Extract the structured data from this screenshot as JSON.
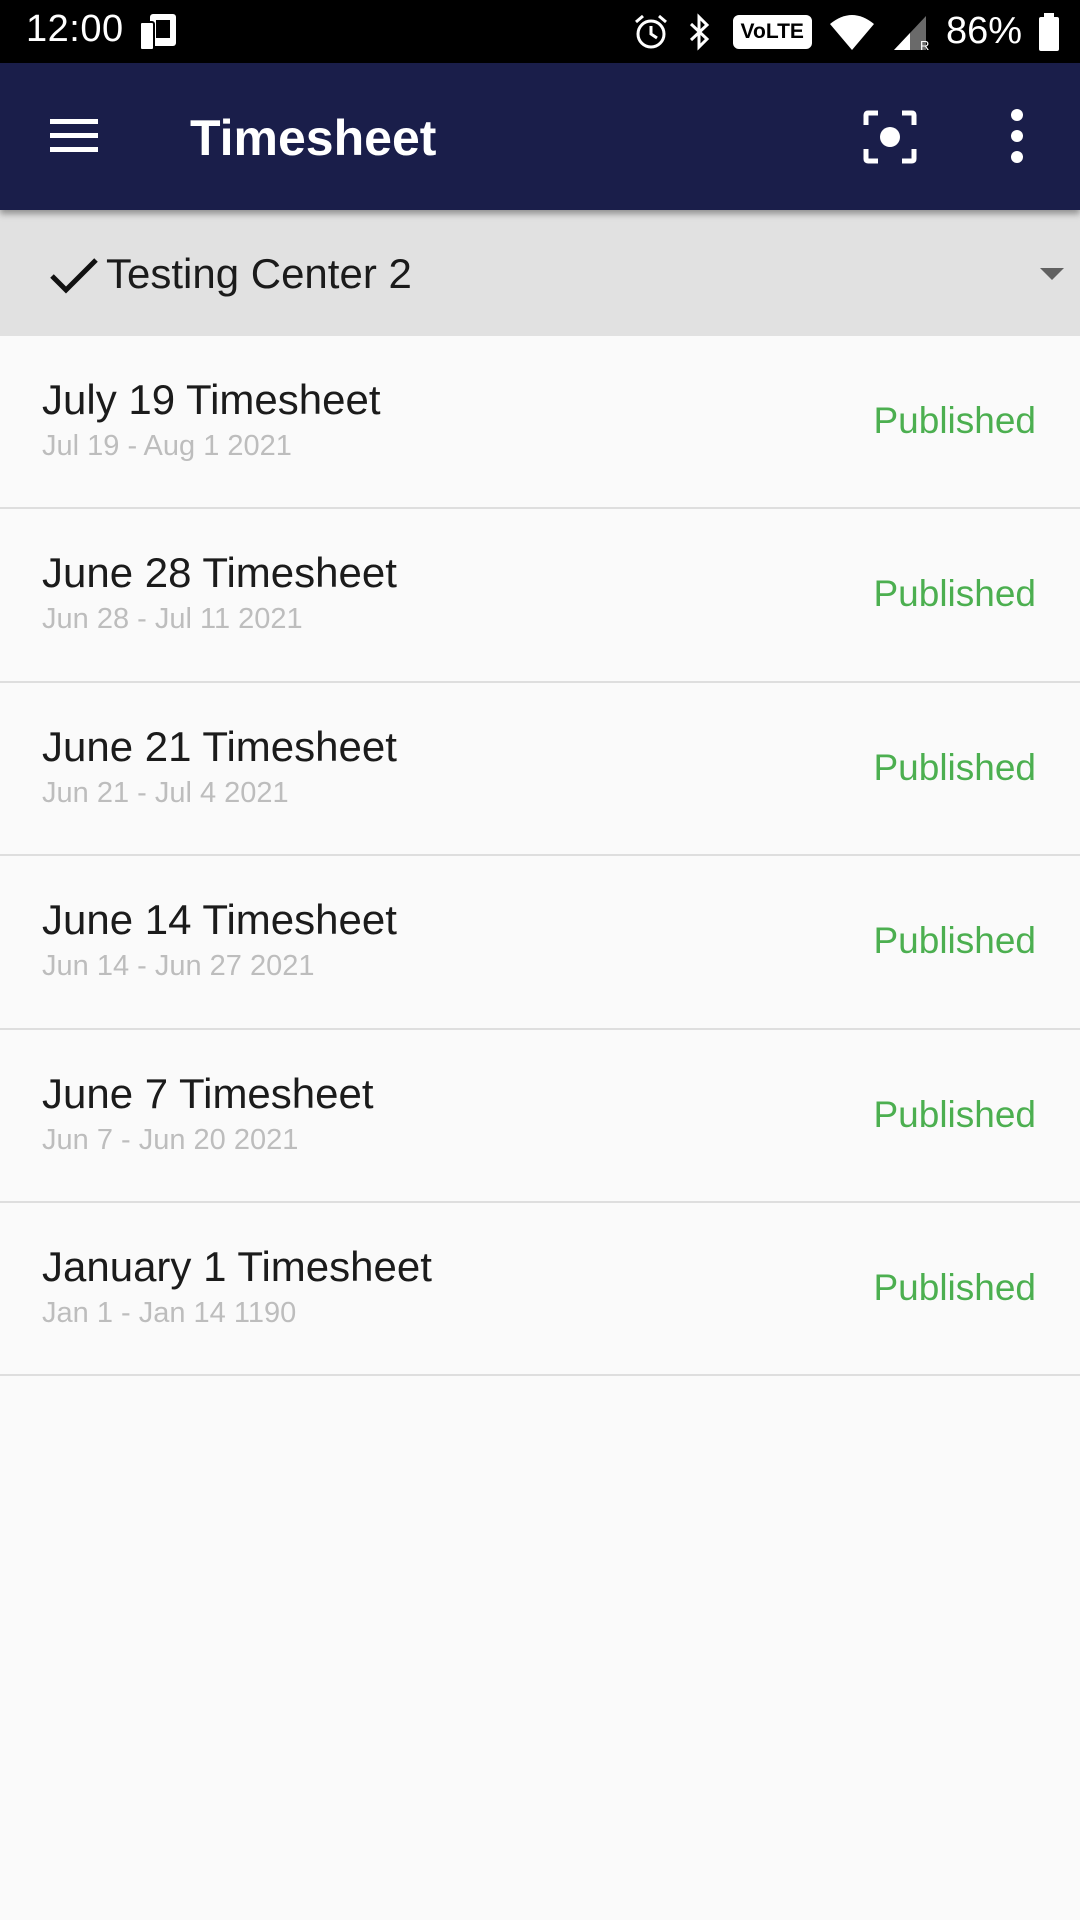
{
  "status_bar": {
    "time": "12:00",
    "volte": "VoLTE",
    "battery": "86%",
    "icons": [
      "phone-sim-icon",
      "alarm-icon",
      "bluetooth-icon",
      "volte-icon",
      "wifi-icon",
      "signal-icon",
      "battery-icon"
    ]
  },
  "app_bar": {
    "title": "Timesheet",
    "icons": [
      "menu-icon",
      "focus-scan-icon",
      "more-vert-icon"
    ],
    "background": "#1a1e4a"
  },
  "selector": {
    "label": "Testing Center 2",
    "icon": "check-icon"
  },
  "timesheets": [
    {
      "title": "July 19 Timesheet",
      "range": "Jul 19 - Aug 1 2021",
      "status": "Published"
    },
    {
      "title": "June 28 Timesheet",
      "range": "Jun 28 - Jul 11 2021",
      "status": "Published"
    },
    {
      "title": "June 21 Timesheet",
      "range": "Jun 21 - Jul 4 2021",
      "status": "Published"
    },
    {
      "title": "June 14 Timesheet",
      "range": "Jun 14 - Jun 27 2021",
      "status": "Published"
    },
    {
      "title": "June 7 Timesheet",
      "range": "Jun 7 - Jun 20 2021",
      "status": "Published"
    },
    {
      "title": "January 1 Timesheet",
      "range": "Jan 1 - Jan 14 1190",
      "status": "Published"
    }
  ],
  "colors": {
    "status_published": "#4caf50",
    "subtitle": "#bdbdbd"
  }
}
